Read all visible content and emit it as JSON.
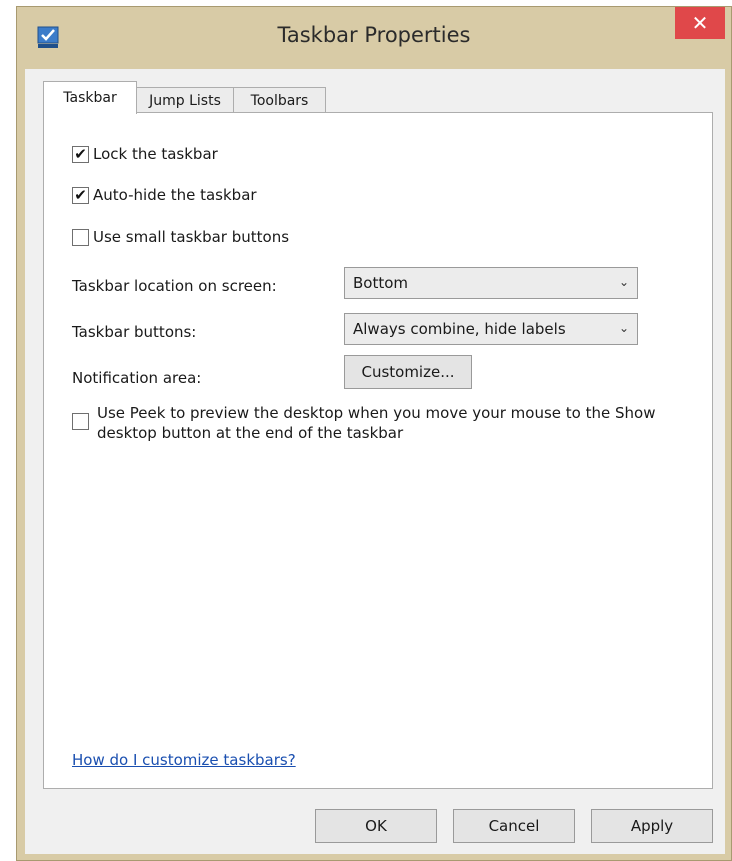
{
  "window": {
    "title": "Taskbar Properties",
    "close_glyph": "✕",
    "colors": {
      "frame": "#d8cba6",
      "close": "#e0484a",
      "link": "#1a4fb0"
    }
  },
  "tabs": [
    {
      "label": "Taskbar",
      "active": true
    },
    {
      "label": "Jump Lists",
      "active": false
    },
    {
      "label": "Toolbars",
      "active": false
    }
  ],
  "taskbar_tab": {
    "lock": {
      "label": "Lock the taskbar",
      "checked": true,
      "mark": "✔"
    },
    "autohide": {
      "label": "Auto-hide the taskbar",
      "checked": true,
      "mark": "✔"
    },
    "small_buttons": {
      "label": "Use small taskbar buttons",
      "checked": false,
      "mark": ""
    },
    "location": {
      "label": "Taskbar location on screen:",
      "value": "Bottom"
    },
    "buttons": {
      "label": "Taskbar buttons:",
      "value": "Always combine, hide labels"
    },
    "notification": {
      "label": "Notification area:",
      "button": "Customize..."
    },
    "peek": {
      "label": "Use Peek to preview the desktop when you move your mouse to the Show desktop button at the end of the taskbar",
      "checked": false,
      "mark": ""
    },
    "help_link": "How do I customize taskbars?"
  },
  "footer": {
    "ok": "OK",
    "cancel": "Cancel",
    "apply": "Apply"
  },
  "icons": {
    "app": "taskbar-properties-icon",
    "chevron": "⌄"
  }
}
